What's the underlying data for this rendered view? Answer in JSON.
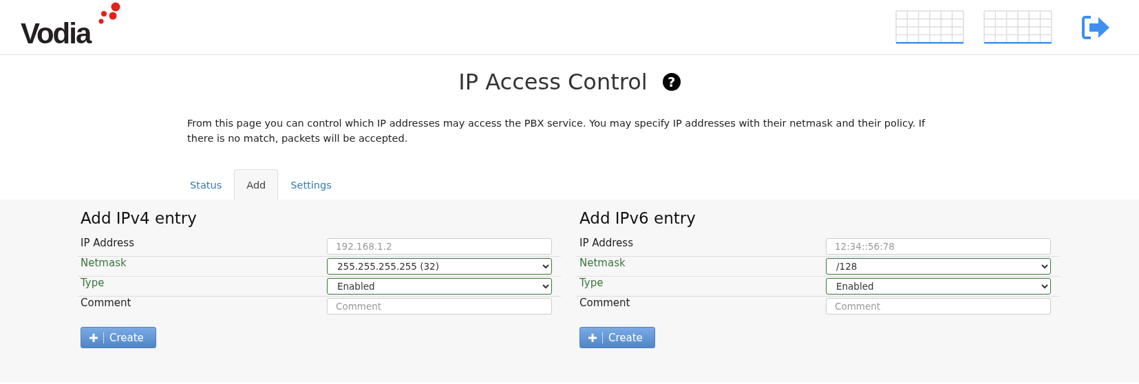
{
  "header": {
    "logo": "Vodia"
  },
  "page": {
    "title": "IP Access Control",
    "help": "?",
    "description": "From this page you can control which IP addresses may access the PBX service. You may specify IP addresses with their netmask and their policy. If there is no match, packets will be accepted."
  },
  "tabs": [
    {
      "label": "Status",
      "selected": false
    },
    {
      "label": "Add",
      "selected": true
    },
    {
      "label": "Settings",
      "selected": false
    }
  ],
  "panels": [
    {
      "title": "Add IPv4 entry",
      "fields": [
        {
          "label": "IP Address",
          "kind": "text",
          "placeholder": "192.168.1.2"
        },
        {
          "label": "Netmask",
          "kind": "select",
          "value": "255.255.255.255 (32)"
        },
        {
          "label": "Type",
          "kind": "select",
          "value": "Enabled"
        },
        {
          "label": "Comment",
          "kind": "text",
          "placeholder": "Comment"
        }
      ],
      "button": "Create"
    },
    {
      "title": "Add IPv6 entry",
      "fields": [
        {
          "label": "IP Address",
          "kind": "text",
          "placeholder": "12:34::56:78"
        },
        {
          "label": "Netmask",
          "kind": "select",
          "value": "/128"
        },
        {
          "label": "Type",
          "kind": "select",
          "value": "Enabled"
        },
        {
          "label": "Comment",
          "kind": "text",
          "placeholder": "Comment"
        }
      ],
      "button": "Create"
    }
  ]
}
